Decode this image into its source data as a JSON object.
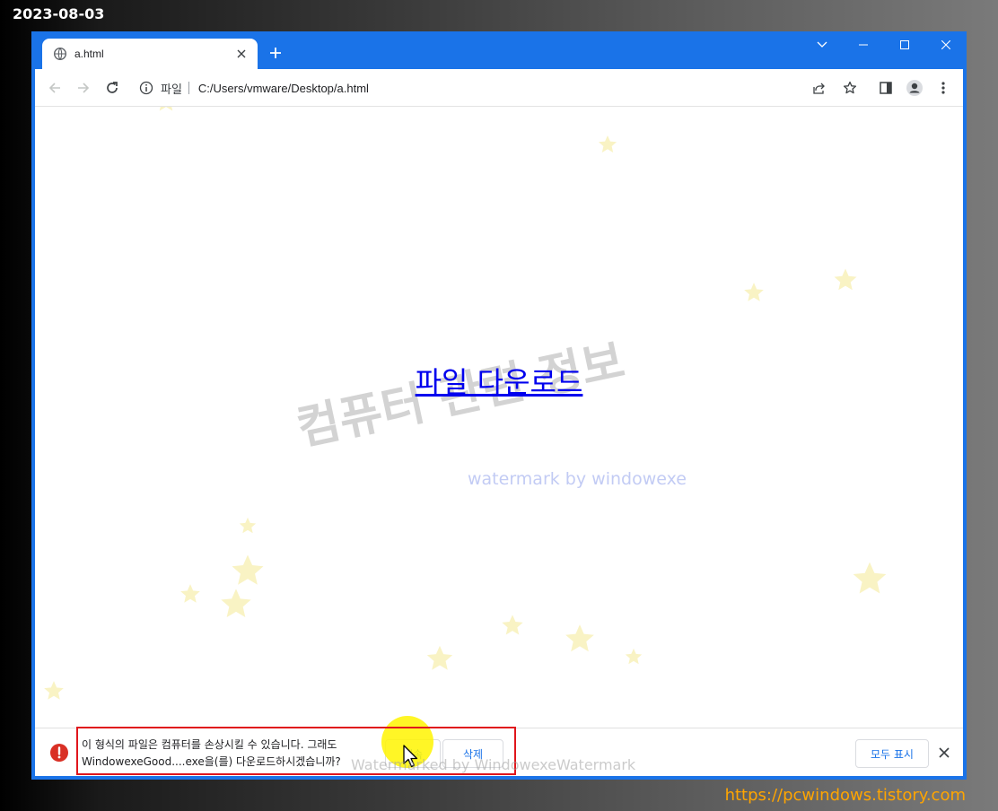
{
  "overlay": {
    "date": "2023-08-03",
    "site_url": "https://pcwindows.tistory.com"
  },
  "browser": {
    "tab_title": "a.html",
    "address_scheme": "파일",
    "address_url": "C:/Users/vmware/Desktop/a.html"
  },
  "page": {
    "download_link": "파일 다운로드",
    "watermark_main": "컴퓨터 관련 정보",
    "watermark_sub": "watermark by windowexe"
  },
  "download_bar": {
    "warning_text": "이 형식의 파일은 컴퓨터를 손상시킬 수 있습니다. 그래도 WindowexeGood....exe을(를) 다운로드하시겠습니까?",
    "keep_label": "계속",
    "delete_label": "삭제",
    "show_all_label": "모두 표시",
    "watermark": "Watermarked by WindowexeWatermark"
  },
  "colors": {
    "chrome_blue": "#1a73e8",
    "warning_red": "#d93025",
    "highlight_red": "#e0161c",
    "link": "#0000ee"
  }
}
